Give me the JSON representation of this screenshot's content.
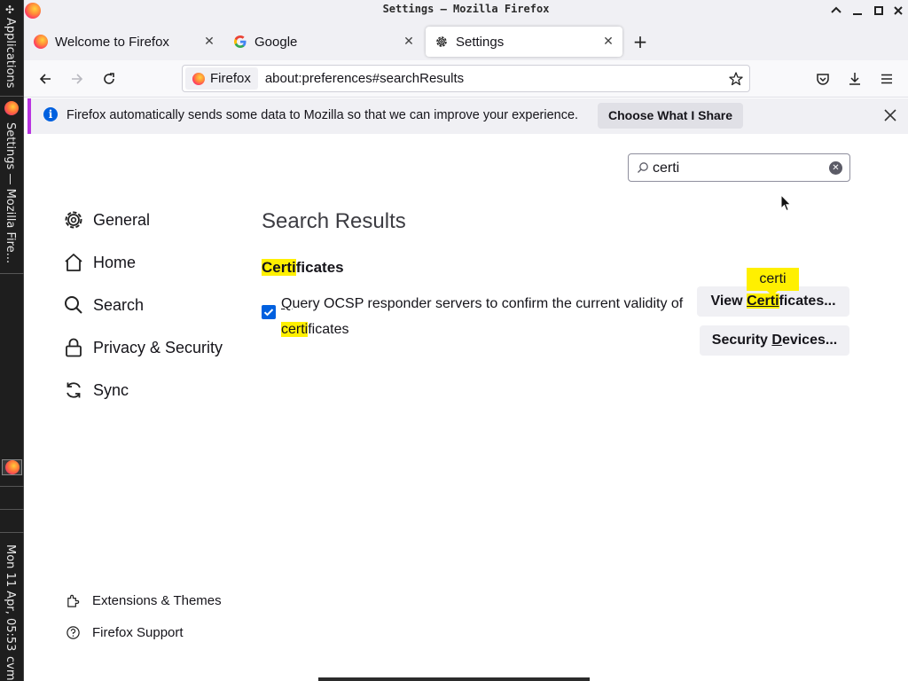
{
  "panel": {
    "applications_label": "Applications",
    "window_label": "Settings — Mozilla Fire...",
    "clock": "Mon 11 Apr, 05:53",
    "user": "cvm"
  },
  "window": {
    "title": "Settings — Mozilla Firefox"
  },
  "tabs": [
    {
      "label": "Welcome to Firefox",
      "icon": "firefox-icon"
    },
    {
      "label": "Google",
      "icon": "google-icon"
    },
    {
      "label": "Settings",
      "icon": "gear-icon",
      "active": true
    }
  ],
  "navbar": {
    "identity_label": "Firefox",
    "url": "about:preferences#searchResults"
  },
  "notification": {
    "text": "Firefox automatically sends some data to Mozilla so that we can improve your experience.",
    "button_label": "Choose What I Share"
  },
  "search": {
    "value": "certi"
  },
  "sidebar": {
    "items": [
      {
        "label": "General",
        "icon": "gear-icon"
      },
      {
        "label": "Home",
        "icon": "home-icon"
      },
      {
        "label": "Search",
        "icon": "search-icon"
      },
      {
        "label": "Privacy & Security",
        "icon": "lock-icon"
      },
      {
        "label": "Sync",
        "icon": "sync-icon"
      }
    ],
    "footer": [
      {
        "label": "Extensions & Themes",
        "icon": "puzzle-icon"
      },
      {
        "label": "Firefox Support",
        "icon": "help-icon"
      }
    ]
  },
  "results": {
    "title": "Search Results",
    "group": {
      "hl": "Certi",
      "rest": "ficates"
    },
    "ocsp": {
      "checked": true,
      "line1_prefix": "Q",
      "line1_rest": "uery OCSP responder servers to confirm the current validity of",
      "line2_hl": "certi",
      "line2_rest": "ficates"
    },
    "view_button": {
      "pre": "View ",
      "hl": "Certi",
      "post": "ficates..."
    },
    "security_button": {
      "pre": "Security ",
      "accel": "D",
      "post": "evices..."
    },
    "tooltip": "certi"
  },
  "colors": {
    "highlight": "#fff000",
    "accent": "#0060df",
    "notification_border": "#b833e1"
  }
}
